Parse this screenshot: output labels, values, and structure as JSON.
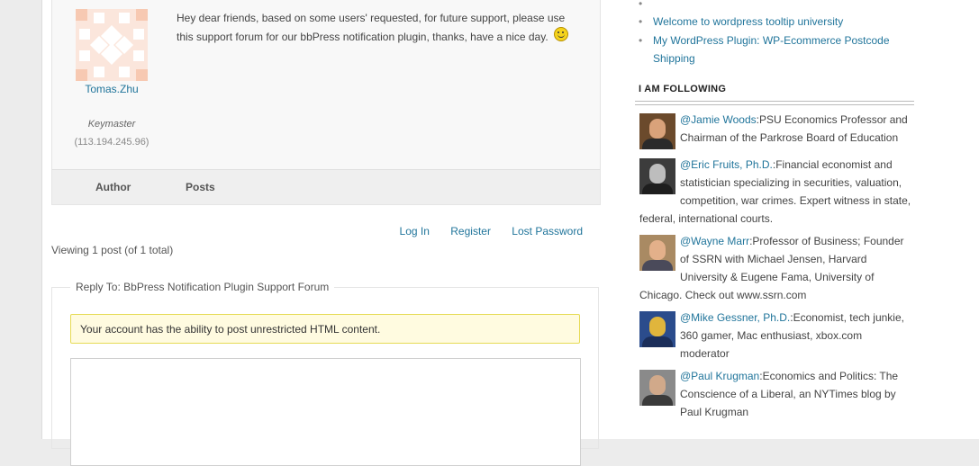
{
  "post": {
    "author_name": "Tomas.Zhu",
    "author_role": "Keymaster",
    "author_ip": "(113.194.245.96)",
    "content": "Hey dear friends, based on some users' requested, for future support, please use this support forum for our bbPress notification plugin, thanks, have a nice day.",
    "avatar_color": "#f7c9b2",
    "smiley_icon": "smiley-icon"
  },
  "table_footer": {
    "author_label": "Author",
    "posts_label": "Posts"
  },
  "login_links": {
    "login": "Log In",
    "register": "Register",
    "lost_password": "Lost Password"
  },
  "viewing": "Viewing 1 post (of 1 total)",
  "reply": {
    "legend": "Reply To: BbPress Notification Plugin Support Forum",
    "notice": "Your account has the ability to post unrestricted HTML content."
  },
  "sidebar": {
    "recent_posts": [
      "Welcome to wordpress tooltip university",
      "My WordPress Plugin: WP-Ecommerce Postcode Shipping"
    ],
    "following_title": "I AM FOLLOWING",
    "following": [
      {
        "handle": "@Jamie Woods",
        "bio": ":PSU Economics Professor and Chairman of the Parkrose Board of Education",
        "bg": "#6b4a2c",
        "skin": "#d9a27a",
        "shirt": "#2a2a2a"
      },
      {
        "handle": "@Eric Fruits, Ph.D.",
        "bio": ":Financial economist and statistician specializing in securities, valuation, competition, war crimes. Expert witness in state, federal, international courts.",
        "bg": "#3c3c3c",
        "skin": "#bdbdbd",
        "shirt": "#1e1e1e"
      },
      {
        "handle": "@Wayne Marr",
        "bio": ":Professor of Business; Founder of SSRN with Michael Jensen, Harvard University & Eugene Fama, University of Chicago. Check out www.ssrn.com",
        "bg": "#a98a63",
        "skin": "#e3b08a",
        "shirt": "#4a4a5a"
      },
      {
        "handle": "@Mike Gessner, Ph.D.",
        "bio": ":Economist, tech junkie, 360 gamer, Mac enthusiast, xbox.com moderator",
        "bg": "#2b4c8c",
        "skin": "#e0b53c",
        "shirt": "#1b2e5a"
      },
      {
        "handle": "@Paul Krugman",
        "bio": ":Economics and Politics: The Conscience of a Liberal, an NYTimes blog by Paul Krugman",
        "bg": "#8a8a8a",
        "skin": "#d1a98a",
        "shirt": "#3a3a3a"
      }
    ]
  },
  "colors": {
    "link": "#21759b",
    "notice_bg": "#fffbe0",
    "notice_border": "#e6db55"
  }
}
